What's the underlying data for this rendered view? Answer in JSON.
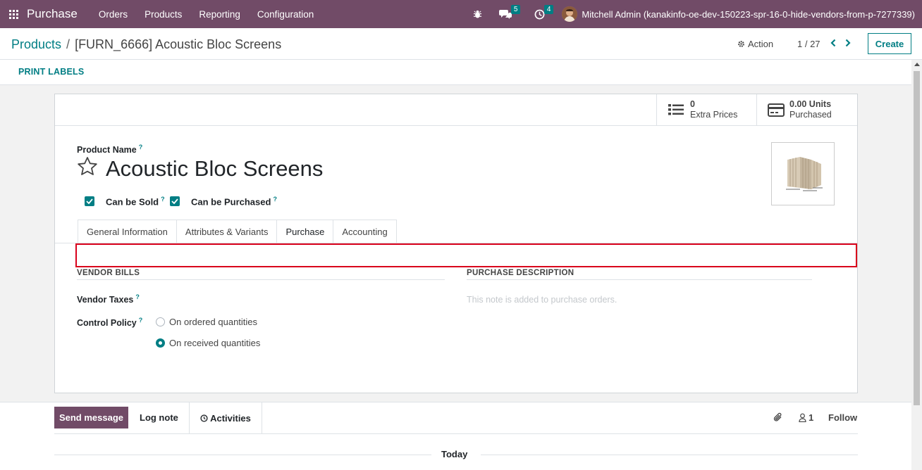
{
  "navbar": {
    "app_name": "Purchase",
    "menu": [
      "Orders",
      "Products",
      "Reporting",
      "Configuration"
    ],
    "messages_count": "5",
    "activities_count": "4",
    "user": "Mitchell Admin (kanakinfo-oe-dev-150223-spr-16-0-hide-vendors-from-p-7277339)"
  },
  "control_panel": {
    "breadcrumb_parent": "Products",
    "breadcrumb_separator": "/",
    "breadcrumb_current": "[FURN_6666] Acoustic Bloc Screens",
    "action_label": "Action",
    "pager": "1 / 27",
    "create_label": "Create",
    "print_labels": "PRINT LABELS"
  },
  "stat_buttons": {
    "extra_prices_value": "0",
    "extra_prices_label": "Extra Prices",
    "purchased_value": "0.00 Units",
    "purchased_label": "Purchased"
  },
  "product": {
    "name_label": "Product Name",
    "name": "Acoustic Bloc Screens",
    "can_be_sold": "Can be Sold",
    "can_be_purchased": "Can be Purchased",
    "help_mark": "?"
  },
  "tabs": [
    "General Information",
    "Attributes & Variants",
    "Purchase",
    "Accounting"
  ],
  "purchase_tab": {
    "vendor_bills_title": "VENDOR BILLS",
    "vendor_taxes_label": "Vendor Taxes",
    "control_policy_label": "Control Policy",
    "option_ordered": "On ordered quantities",
    "option_received": "On received quantities",
    "purchase_description_title": "PURCHASE DESCRIPTION",
    "purchase_description_placeholder": "This note is added to purchase orders."
  },
  "chatter": {
    "send_message": "Send message",
    "log_note": "Log note",
    "activities": "Activities",
    "followers_count": "1",
    "follow": "Follow",
    "today": "Today"
  },
  "colors": {
    "brand": "#714b67",
    "accent": "#017e84",
    "highlight_box": "#d9001b"
  }
}
